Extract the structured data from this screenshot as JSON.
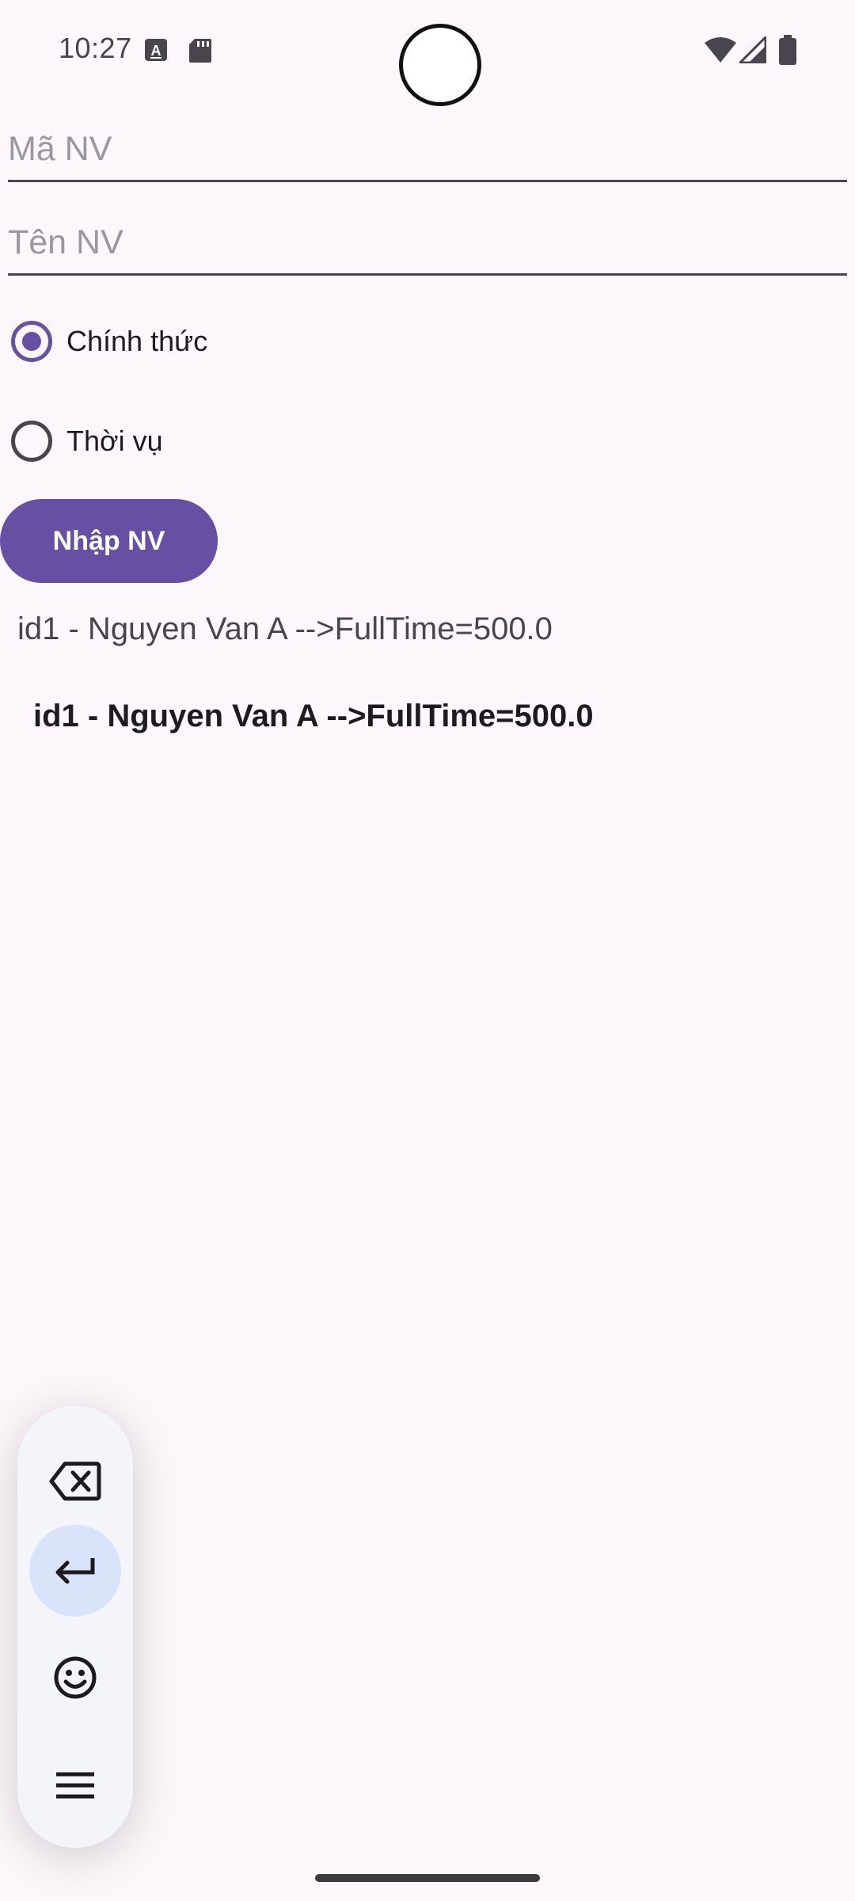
{
  "status_bar": {
    "time": "10:27"
  },
  "form": {
    "ma_nv_placeholder": "Mã NV",
    "ten_nv_placeholder": "Tên NV",
    "radio_options": [
      {
        "label": "Chính thức",
        "checked": true
      },
      {
        "label": "Thời vụ",
        "checked": false
      }
    ],
    "submit_label": "Nhập NV"
  },
  "result": {
    "text": "id1 - Nguyen Van A -->FullTime=500.0"
  },
  "list": {
    "items": [
      {
        "text": "id1 - Nguyen Van A -->FullTime=500.0"
      }
    ]
  },
  "keyboard_toolbar": {
    "icons": [
      "backspace-icon",
      "enter-icon",
      "emoji-icon",
      "menu-icon"
    ]
  },
  "colors": {
    "accent": "#6750a4",
    "background": "#fdf7fb"
  }
}
